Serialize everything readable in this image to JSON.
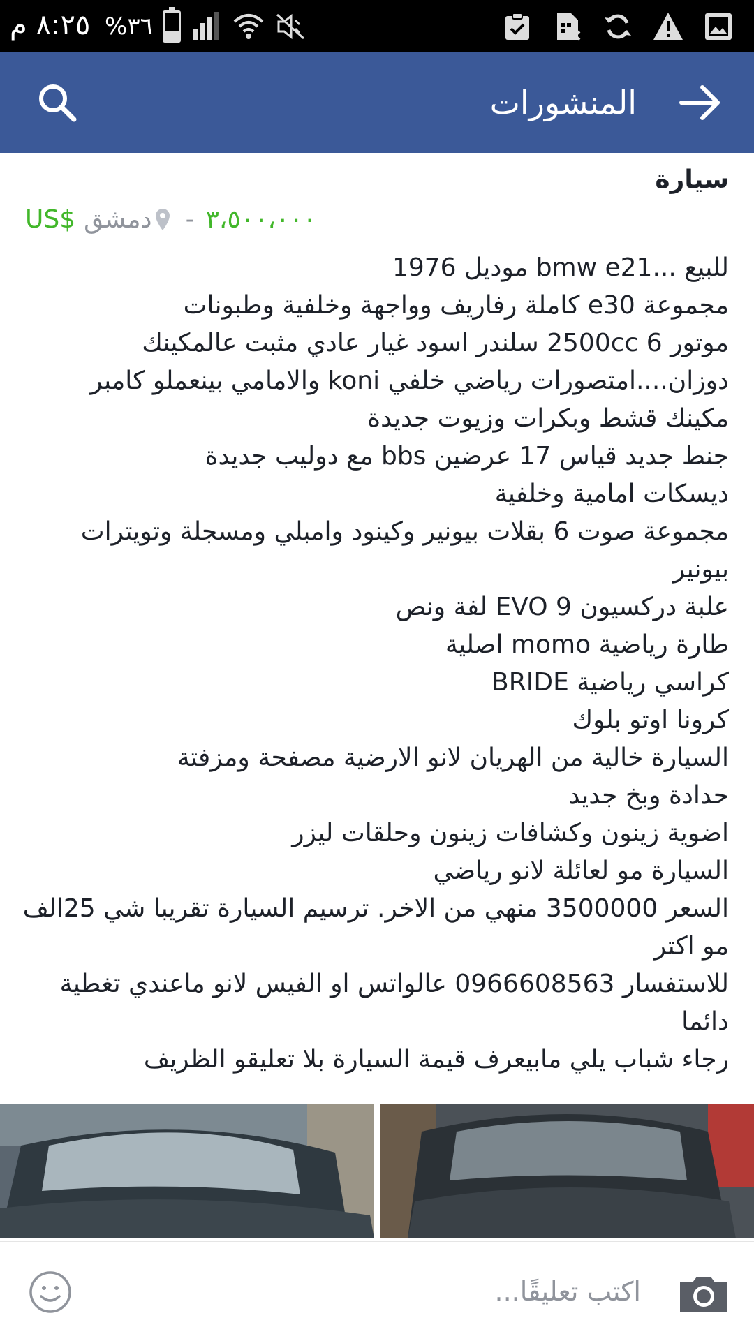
{
  "status_bar": {
    "time": "٨:٢٥ م",
    "battery_text": "%٣٦",
    "battery_level": 0.36,
    "icons": [
      "battery-icon",
      "signal-icon",
      "wifi-icon",
      "mute-icon",
      "clipboard-check-icon",
      "sim-card-icon",
      "sync-icon",
      "warning-icon",
      "image-icon"
    ]
  },
  "app_bar": {
    "title": "المنشورات",
    "back_icon": "arrow-right-icon",
    "search_icon": "search-icon",
    "color": "#3b5998"
  },
  "post": {
    "title": "سيارة",
    "price": "٣،٥٠٠،٠٠٠",
    "separator": "-",
    "location": "دمشق",
    "currency": "US$",
    "price_color": "#42b72a",
    "description_lines": [
      "للبيع ...bmw e21 موديل 1976",
      "مجموعة e30 كاملة رفاريف وواجهة وخلفية وطبونات",
      "موتور 6  2500cc سلندر اسود غيار عادي مثبت عالمكينك",
      "دوزان....امتصورات رياضي خلفي  koni والامامي بينعملو كامبر",
      "مكينك قشط وبكرات وزيوت جديدة",
      "جنط جديد قياس 17 عرضين bbs مع دوليب جديدة",
      "ديسكات امامية وخلفية",
      "مجموعة صوت 6 بقلات بيونير وكينود وامبلي ومسجلة وتويترات",
      "بيونير",
      "علبة دركسيون EVO 9 لفة ونص",
      "طارة رياضية momo اصلية",
      "كراسي رياضية BRIDE",
      "كرونا اوتو بلوك",
      "السيارة خالية من الهريان لانو الارضية مصفحة ومزفتة",
      "حدادة وبخ جديد",
      "اضوية زينون وكشافات زينون وحلقات ليزر",
      "السيارة مو لعائلة لانو رياضي",
      "السعر 3500000 منهي من الاخر. ترسيم السيارة تقريبا شي 25الف",
      "مو اكتر",
      "للاستفسار 0966608563 عالواتس او الفيس لانو ماعندي تغطية",
      "دائما",
      "رجاء شباب يلي مابيعرف قيمة السيارة بلا تعليقو الظريف"
    ]
  },
  "photos": [
    {
      "name": "car-photo-1"
    },
    {
      "name": "car-photo-2"
    }
  ],
  "comment_bar": {
    "placeholder": "اكتب تعليقًا...",
    "emoji_icon": "emoji-icon",
    "camera_icon": "camera-icon"
  }
}
